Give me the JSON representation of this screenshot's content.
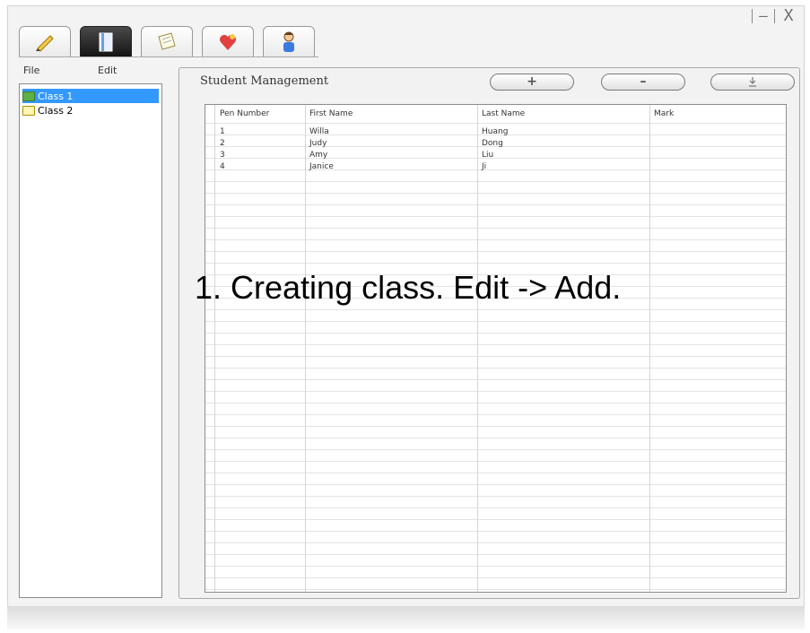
{
  "window": {
    "minimize_label": "–",
    "close_label": "X"
  },
  "toolbar": {
    "tabs": [
      {
        "icon": "pencil-icon",
        "active": false
      },
      {
        "icon": "book-icon",
        "active": true
      },
      {
        "icon": "notepad-icon",
        "active": false
      },
      {
        "icon": "heart-icon",
        "active": false
      },
      {
        "icon": "student-icon",
        "active": false
      }
    ]
  },
  "sidebar": {
    "menu": {
      "file": "File",
      "edit": "Edit"
    },
    "classes": [
      {
        "label": "Class 1",
        "selected": true
      },
      {
        "label": "Class 2",
        "selected": false
      }
    ]
  },
  "main": {
    "title": "Student Management",
    "buttons": {
      "add": "+",
      "remove": "–"
    },
    "table": {
      "headers": [
        "Pen Number",
        "First Name",
        "Last Name",
        "Mark"
      ],
      "rows": [
        [
          "1",
          "Willa",
          "Huang",
          ""
        ],
        [
          "2",
          "Judy",
          "Dong",
          ""
        ],
        [
          "3",
          "Amy",
          "Liu",
          ""
        ],
        [
          "4",
          "Janice",
          "Ji",
          ""
        ]
      ]
    }
  },
  "overlay": {
    "text": "1. Creating class. Edit -> Add."
  },
  "colors": {
    "selection": "#3399ff",
    "active_tab": "#1a1a1a"
  }
}
